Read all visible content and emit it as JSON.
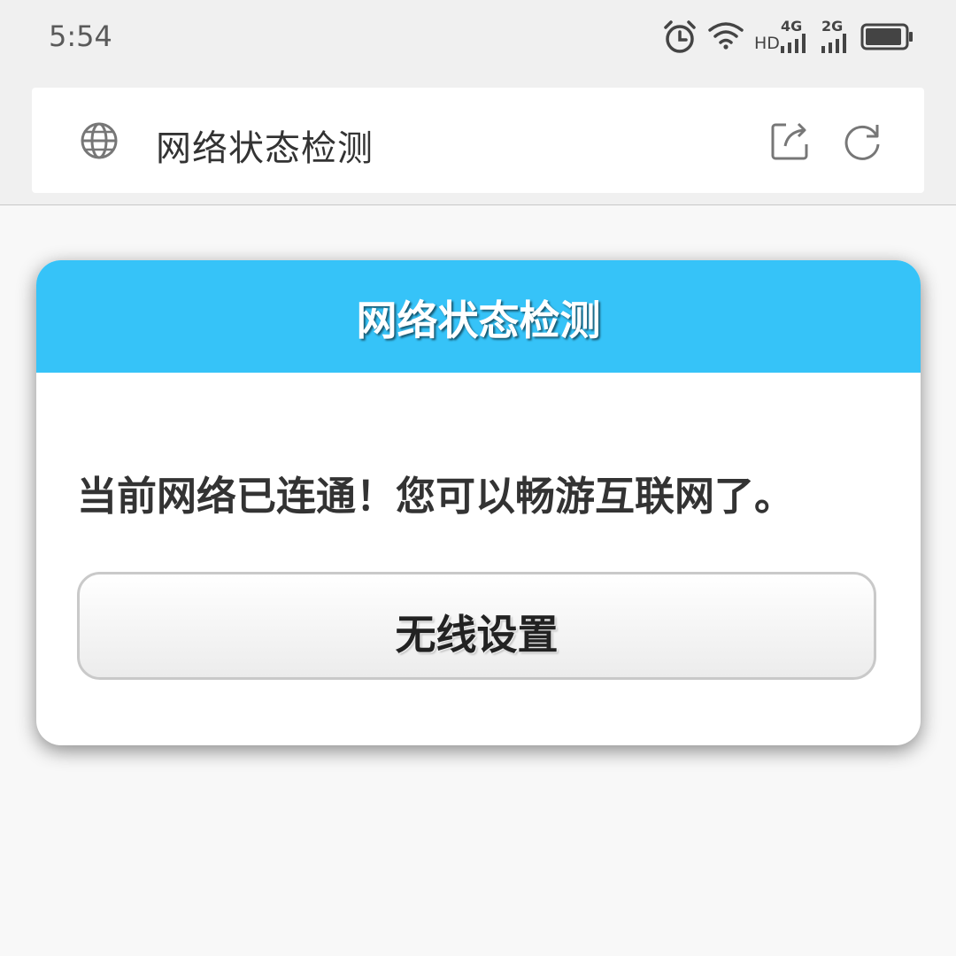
{
  "status_bar": {
    "time": "5:54",
    "network_1": "4G",
    "network_2": "2G",
    "hd": "HD",
    "icons": [
      "alarm-icon",
      "wifi-icon",
      "signal-4g-icon",
      "signal-2g-icon",
      "battery-icon"
    ]
  },
  "browser": {
    "title": "网络状态检测",
    "icons": [
      "globe-icon",
      "share-icon",
      "refresh-icon"
    ]
  },
  "dialog": {
    "title": "网络状态检测",
    "message": "当前网络已连通！您可以畅游互联网了。",
    "button_label": "无线设置",
    "header_color": "#36c3f8"
  }
}
